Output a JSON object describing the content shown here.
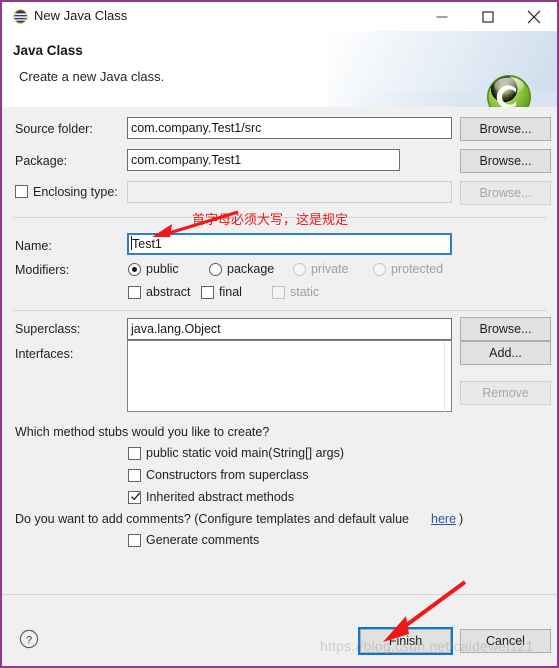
{
  "window": {
    "title": "New Java Class",
    "icon": "java-class-icon",
    "minimize_label": "—",
    "maximize_label": "□",
    "close_label": "✕",
    "border_color": "#8E3A8E"
  },
  "header": {
    "title": "Java Class",
    "subtitle": "Create a new Java class.",
    "logo": "green-c-sphere-logo"
  },
  "form": {
    "source_folder": {
      "label": "Source folder:",
      "value": "com.company.Test1/src",
      "browse_label": "Browse..."
    },
    "package": {
      "label": "Package:",
      "value": "com.company.Test1",
      "browse_label": "Browse..."
    },
    "enclosing_type": {
      "label": "Enclosing type:",
      "checked": false,
      "value": "",
      "browse_label": "Browse...",
      "disabled": true
    },
    "name": {
      "label": "Name:",
      "value": "Test1",
      "focused": true
    },
    "modifiers": {
      "label": "Modifiers:",
      "radios": [
        {
          "label": "public",
          "selected": true,
          "disabled": false
        },
        {
          "label": "package",
          "selected": false,
          "disabled": false
        },
        {
          "label": "private",
          "selected": false,
          "disabled": true
        },
        {
          "label": "protected",
          "selected": false,
          "disabled": true
        }
      ],
      "checkboxes": [
        {
          "label": "abstract",
          "checked": false,
          "disabled": false
        },
        {
          "label": "final",
          "checked": false,
          "disabled": false
        },
        {
          "label": "static",
          "checked": false,
          "disabled": true
        }
      ]
    },
    "superclass": {
      "label": "Superclass:",
      "value": "java.lang.Object",
      "browse_label": "Browse..."
    },
    "interfaces": {
      "label": "Interfaces:",
      "items": [],
      "add_label": "Add...",
      "remove_label": "Remove",
      "remove_disabled": true
    }
  },
  "stubs": {
    "question": "Which method stubs would you like to create?",
    "options": [
      {
        "label": "public static void main(String[] args)",
        "checked": false
      },
      {
        "label": "Constructors from superclass",
        "checked": false
      },
      {
        "label": "Inherited abstract methods",
        "checked": true
      }
    ]
  },
  "comments": {
    "question_prefix": "Do you want to add comments? (Configure templates and default value ",
    "link_label": "here",
    "question_suffix": ")",
    "option": {
      "label": "Generate comments",
      "checked": false
    }
  },
  "footer": {
    "help_label": "?",
    "finish_label": "Finish",
    "cancel_label": "Cancel",
    "finish_focused": true
  },
  "annotations": {
    "name_note": "首字母必须大写，这是规定",
    "note_color": "#F01818",
    "arrow_to_name": "red-arrow-icon",
    "arrow_to_finish": "red-arrow-icon",
    "watermark": "https://blog.csdn.net/caidewei121"
  }
}
